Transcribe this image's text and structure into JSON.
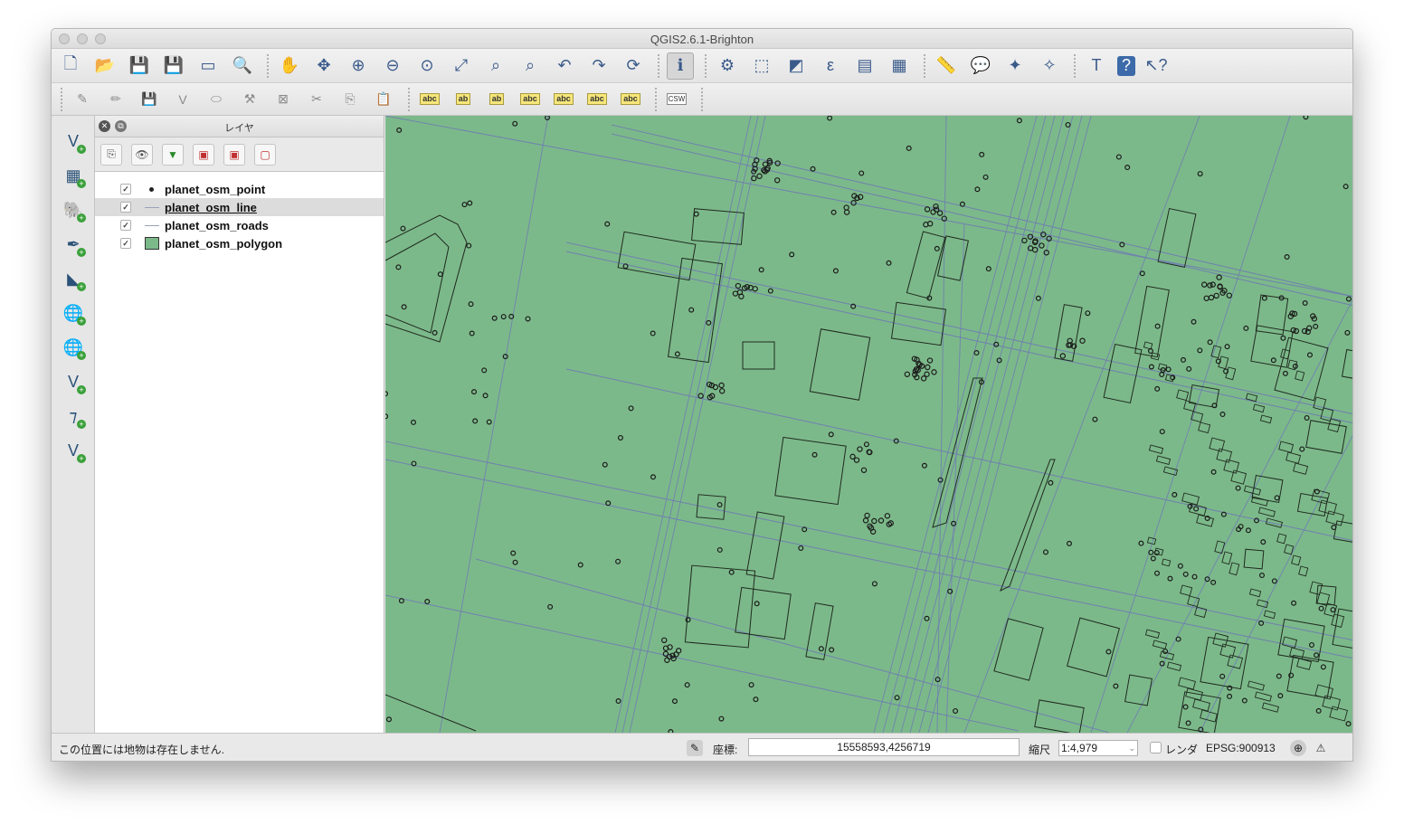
{
  "window": {
    "title": "QGIS2.6.1-Brighton"
  },
  "toolbar_main": [
    {
      "name": "new-project-icon",
      "glyph": "🗋"
    },
    {
      "name": "open-project-icon",
      "glyph": "📂"
    },
    {
      "name": "save-project-icon",
      "glyph": "💾"
    },
    {
      "name": "save-as-icon",
      "glyph": "💾"
    },
    {
      "name": "new-print-composer-icon",
      "glyph": "▭"
    },
    {
      "name": "composer-manager-icon",
      "glyph": "🔍"
    },
    {
      "name": "pan-icon",
      "glyph": "✋"
    },
    {
      "name": "pan-to-selection-icon",
      "glyph": "✥"
    },
    {
      "name": "zoom-in-icon",
      "glyph": "⊕"
    },
    {
      "name": "zoom-out-icon",
      "glyph": "⊖"
    },
    {
      "name": "zoom-actual-size-icon",
      "glyph": "⊙"
    },
    {
      "name": "zoom-full-icon",
      "glyph": "⤢"
    },
    {
      "name": "zoom-to-selection-icon",
      "glyph": "⌕"
    },
    {
      "name": "zoom-to-layer-icon",
      "glyph": "⌕"
    },
    {
      "name": "zoom-last-icon",
      "glyph": "↶"
    },
    {
      "name": "zoom-next-icon",
      "glyph": "↷"
    },
    {
      "name": "refresh-icon",
      "glyph": "⟳"
    },
    {
      "name": "identify-icon",
      "glyph": "ℹ"
    },
    {
      "name": "action-icon",
      "glyph": "⚙"
    },
    {
      "name": "select-features-icon",
      "glyph": "⬚"
    },
    {
      "name": "deselect-icon",
      "glyph": "◩"
    },
    {
      "name": "field-calculator-icon",
      "glyph": "ε"
    },
    {
      "name": "attribute-table-icon",
      "glyph": "▤"
    },
    {
      "name": "statistics-icon",
      "glyph": "▦"
    },
    {
      "name": "measure-icon",
      "glyph": "📏"
    },
    {
      "name": "map-tips-icon",
      "glyph": "💬"
    },
    {
      "name": "new-bookmark-icon",
      "glyph": "✦"
    },
    {
      "name": "show-bookmarks-icon",
      "glyph": "✧"
    },
    {
      "name": "text-annotation-icon",
      "glyph": "T"
    },
    {
      "name": "help-icon",
      "glyph": "?"
    },
    {
      "name": "whats-this-icon",
      "glyph": "↖?"
    }
  ],
  "toolbar_edit": [
    {
      "name": "current-edits-icon",
      "glyph": "✎"
    },
    {
      "name": "toggle-editing-icon",
      "glyph": "✏"
    },
    {
      "name": "save-edits-icon",
      "glyph": "💾"
    },
    {
      "name": "add-feature-icon",
      "glyph": "V"
    },
    {
      "name": "move-feature-icon",
      "glyph": "⬭"
    },
    {
      "name": "node-tool-icon",
      "glyph": "⚒"
    },
    {
      "name": "delete-selected-icon",
      "glyph": "⊠"
    },
    {
      "name": "cut-features-icon",
      "glyph": "✂"
    },
    {
      "name": "copy-features-icon",
      "glyph": "⎘"
    },
    {
      "name": "paste-features-icon",
      "glyph": "📋"
    }
  ],
  "toolbar_label": [
    {
      "name": "label-icon",
      "text": "abc"
    },
    {
      "name": "layer-labeling-icon",
      "text": "ab"
    },
    {
      "name": "pin-label-icon",
      "text": "ab"
    },
    {
      "name": "show-hide-labels-icon",
      "text": "abc"
    },
    {
      "name": "move-label-icon",
      "text": "abc"
    },
    {
      "name": "rotate-label-icon",
      "text": "abc"
    },
    {
      "name": "change-label-icon",
      "text": "abc"
    }
  ],
  "csw_label": "CSW",
  "left_toolbar": [
    {
      "name": "add-vector-layer-icon",
      "glyph": "V"
    },
    {
      "name": "add-raster-layer-icon",
      "glyph": "▦"
    },
    {
      "name": "add-postgis-layer-icon",
      "glyph": "🐘"
    },
    {
      "name": "add-spatialite-layer-icon",
      "glyph": "✒"
    },
    {
      "name": "add-mssql-layer-icon",
      "glyph": "◣"
    },
    {
      "name": "add-wms-layer-icon",
      "glyph": "🌐"
    },
    {
      "name": "add-wcs-layer-icon",
      "glyph": "🌐"
    },
    {
      "name": "add-wfs-layer-icon",
      "glyph": "V"
    },
    {
      "name": "add-delimited-text-icon",
      "glyph": "⁊"
    },
    {
      "name": "new-shapefile-icon",
      "glyph": "V"
    }
  ],
  "layers_panel": {
    "title": "レイヤ",
    "layers": [
      {
        "name": "planet_osm_point",
        "checked": "✓",
        "symbol": "point"
      },
      {
        "name": "planet_osm_line",
        "checked": "✓",
        "symbol": "line",
        "selected": true
      },
      {
        "name": "planet_osm_roads",
        "checked": "✓",
        "symbol": "line"
      },
      {
        "name": "planet_osm_polygon",
        "checked": "✓",
        "symbol": "polygon"
      }
    ]
  },
  "colors": {
    "map_fill": "#7cb98a",
    "road_line": "#6f7fb0",
    "polygon_stroke": "#1f2a1f",
    "point": "#1a1a1a",
    "polygon_swatch": "#7cb98a"
  },
  "statusbar": {
    "message": "この位置には地物は存在しません.",
    "coord_label": "座標:",
    "coord_value": "15558593,4256719",
    "scale_label": "縮尺",
    "scale_value": "1:4,979",
    "render_label": "レンダ",
    "crs": "EPSG:900913"
  }
}
